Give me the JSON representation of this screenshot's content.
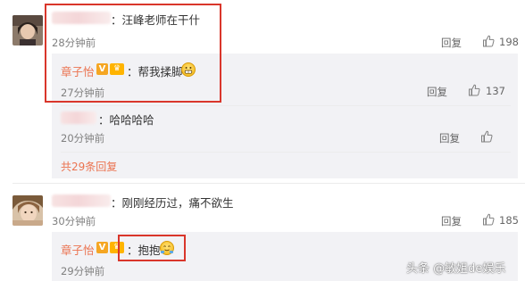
{
  "comments": [
    {
      "text": "：汪峰老师在干什",
      "time": "28分钟前",
      "reply_label": "回复",
      "like_count": "198"
    },
    {
      "text": "：刚刚经历过，痛不欲生",
      "time": "30分钟前",
      "reply_label": "回复",
      "like_count": "185"
    }
  ],
  "replies": [
    {
      "user": "章子怡",
      "text": "：帮我揉脚",
      "time": "27分钟前",
      "reply_label": "回复",
      "like_count": "137"
    },
    {
      "text": "：哈哈哈哈",
      "time": "20分钟前",
      "reply_label": "回复",
      "like_count": ""
    },
    {
      "user": "章子怡",
      "text": "：抱抱",
      "time": "29分钟前",
      "reply_label": "",
      "like_count": ""
    }
  ],
  "more_replies_link": "共29条回复",
  "watermark": "头条 @敏姐de娱乐",
  "colors": {
    "username": "#eb7350",
    "highlight_box": "#d9362b",
    "reply_background": "#f2f2f5"
  }
}
